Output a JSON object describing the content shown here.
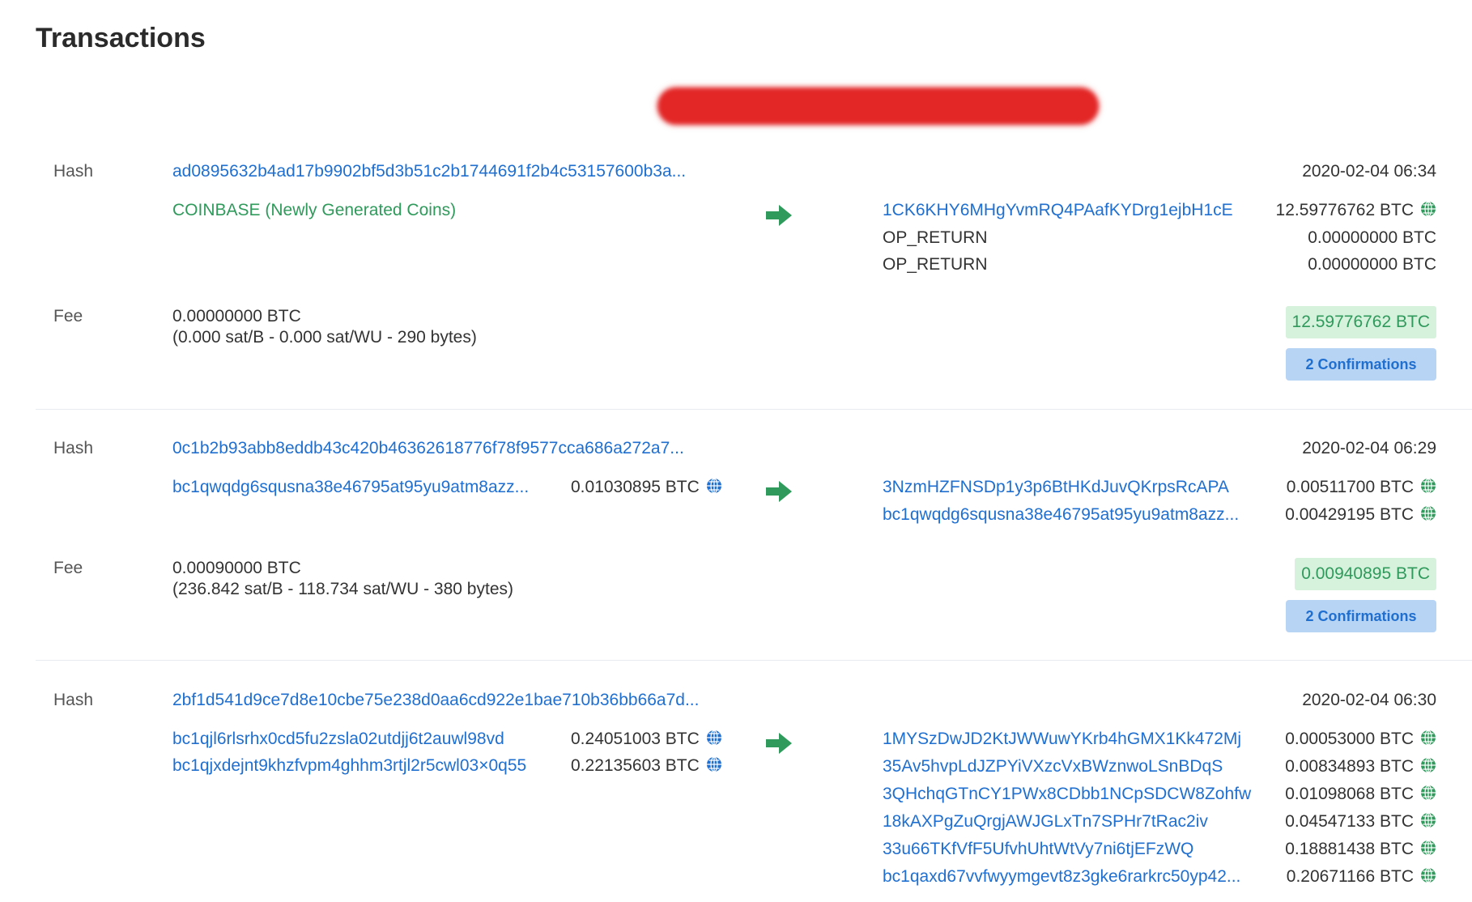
{
  "page": {
    "title": "Transactions"
  },
  "labels": {
    "hash": "Hash",
    "fee": "Fee"
  },
  "colors": {
    "link": "#1f6fd0",
    "coinbase": "#2f9a5b",
    "redaction": "#e32626",
    "total_bg": "#d6f1dc",
    "confirm_bg": "#b8d4f5"
  },
  "transactions": [
    {
      "hash": "ad0895632b4ad17b9902bf5d3b51c2b1744691f2b4c53157600b3a...",
      "time": "2020-02-04 06:34",
      "inputs": [
        {
          "address": "COINBASE (Newly Generated Coins)",
          "coinbase": true
        }
      ],
      "outputs": [
        {
          "address": "1CK6KHY6MHgYvmRQ4PAafKYDrg1ejbH1cE",
          "amount": "12.59776762 BTC",
          "link": true,
          "globe": true
        },
        {
          "address": "OP_RETURN",
          "amount": "0.00000000 BTC",
          "link": false,
          "globe": false
        },
        {
          "address": "OP_RETURN",
          "amount": "0.00000000 BTC",
          "link": false,
          "globe": false
        }
      ],
      "fee": "0.00000000 BTC",
      "fee_detail": "(0.000 sat/B - 0.000 sat/WU - 290 bytes)",
      "total": "12.59776762 BTC",
      "confirmations": "2 Confirmations"
    },
    {
      "hash": "0c1b2b93abb8eddb43c420b46362618776f78f9577cca686a272a7...",
      "time": "2020-02-04 06:29",
      "inputs": [
        {
          "address": "bc1qwqdg6squsna38e46795at95yu9atm8azz...",
          "amount": "0.01030895 BTC"
        }
      ],
      "outputs": [
        {
          "address": "3NzmHZFNSDp1y3p6BtHKdJuvQKrpsRcAPA",
          "amount": "0.00511700 BTC",
          "link": true,
          "globe": true
        },
        {
          "address": "bc1qwqdg6squsna38e46795at95yu9atm8azz...",
          "amount": "0.00429195 BTC",
          "link": true,
          "globe": true
        }
      ],
      "fee": "0.00090000 BTC",
      "fee_detail": "(236.842 sat/B - 118.734 sat/WU - 380 bytes)",
      "total": "0.00940895 BTC",
      "confirmations": "2 Confirmations"
    },
    {
      "hash": "2bf1d541d9ce7d8e10cbe75e238d0aa6cd922e1bae710b36bb66a7d...",
      "time": "2020-02-04 06:30",
      "inputs": [
        {
          "address": "bc1qjl6rlsrhx0cd5fu2zsla02utdjj6t2auwl98vd",
          "amount": "0.24051003 BTC"
        },
        {
          "address": "bc1qjxdejnt9khzfvpm4ghhm3rtjl2r5cwl03×0q55",
          "amount": "0.22135603 BTC"
        }
      ],
      "outputs": [
        {
          "address": "1MYSzDwJD2KtJWWuwYKrb4hGMX1Kk472Mj",
          "amount": "0.00053000 BTC",
          "link": true,
          "globe": true
        },
        {
          "address": "35Av5hvpLdJZPYiVXzcVxBWznwoLSnBDqS",
          "amount": "0.00834893 BTC",
          "link": true,
          "globe": true
        },
        {
          "address": "3QHchqGTnCY1PWx8CDbb1NCpSDCW8Zohfw",
          "amount": "0.01098068 BTC",
          "link": true,
          "globe": true
        },
        {
          "address": "18kAXPgZuQrgjAWJGLxTn7SPHr7tRac2iv",
          "amount": "0.04547133 BTC",
          "link": true,
          "globe": true
        },
        {
          "address": "33u66TKfVfF5UfvhUhtWtVy7ni6tjEFzWQ",
          "amount": "0.18881438 BTC",
          "link": true,
          "globe": true
        },
        {
          "address": "bc1qaxd67vvfwyymgevt8z3gke6rarkrc50yp42...",
          "amount": "0.20671166 BTC",
          "link": true,
          "globe": true
        }
      ]
    }
  ]
}
